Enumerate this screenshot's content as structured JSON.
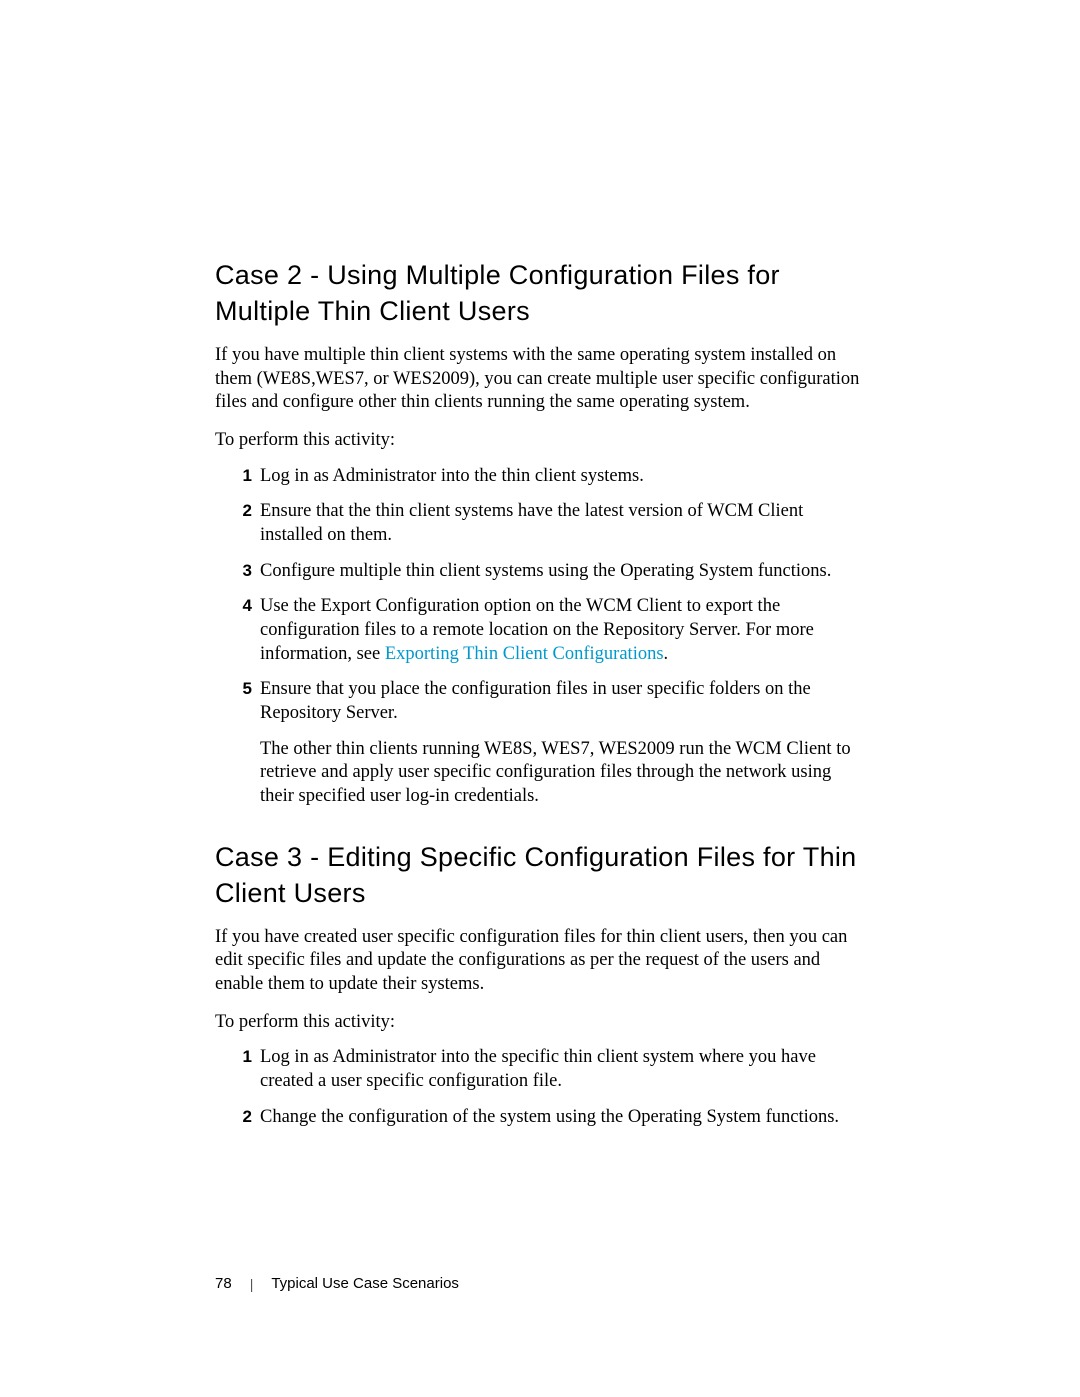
{
  "sections": [
    {
      "heading": "Case 2 - Using Multiple Configuration Files for Multiple Thin Client Users",
      "intro": "If you have multiple thin client systems with the same operating system installed on them (WE8S,WES7, or WES2009), you can create multiple user specific configuration files and configure other thin clients running the same operating system.",
      "activity_label": "To perform this activity:",
      "steps": [
        {
          "num": "1",
          "text": "Log in as Administrator into the thin client systems."
        },
        {
          "num": "2",
          "text": "Ensure that the thin client systems have the latest version of WCM Client installed on them."
        },
        {
          "num": "3",
          "text": "Configure multiple thin client systems using the Operating System functions."
        },
        {
          "num": "4",
          "text_pre": "Use the Export Configuration option on the WCM Client to export the configuration files to a remote location on the Repository Server. For more information, see ",
          "link": "Exporting Thin Client Configurations",
          "text_post": "."
        },
        {
          "num": "5",
          "text": "Ensure that you place the configuration files in user specific folders on the Repository Server.",
          "sub": "The other thin clients running WE8S, WES7, WES2009 run the WCM Client to retrieve and apply user specific configuration files through the network using their specified user log-in credentials."
        }
      ]
    },
    {
      "heading": "Case 3 - Editing Specific Configuration Files for Thin Client Users",
      "intro": "If you have created user specific configuration files for thin client users, then you can edit specific files and update the configurations as per the request of the users and enable them to update their systems.",
      "activity_label": "To perform this activity:",
      "steps": [
        {
          "num": "1",
          "text": "Log in as Administrator into the specific thin client system where you have created a user specific configuration file."
        },
        {
          "num": "2",
          "text": "Change the configuration of the system using the Operating System functions."
        }
      ]
    }
  ],
  "footer": {
    "page_number": "78",
    "divider": "|",
    "title": "Typical Use Case Scenarios"
  }
}
